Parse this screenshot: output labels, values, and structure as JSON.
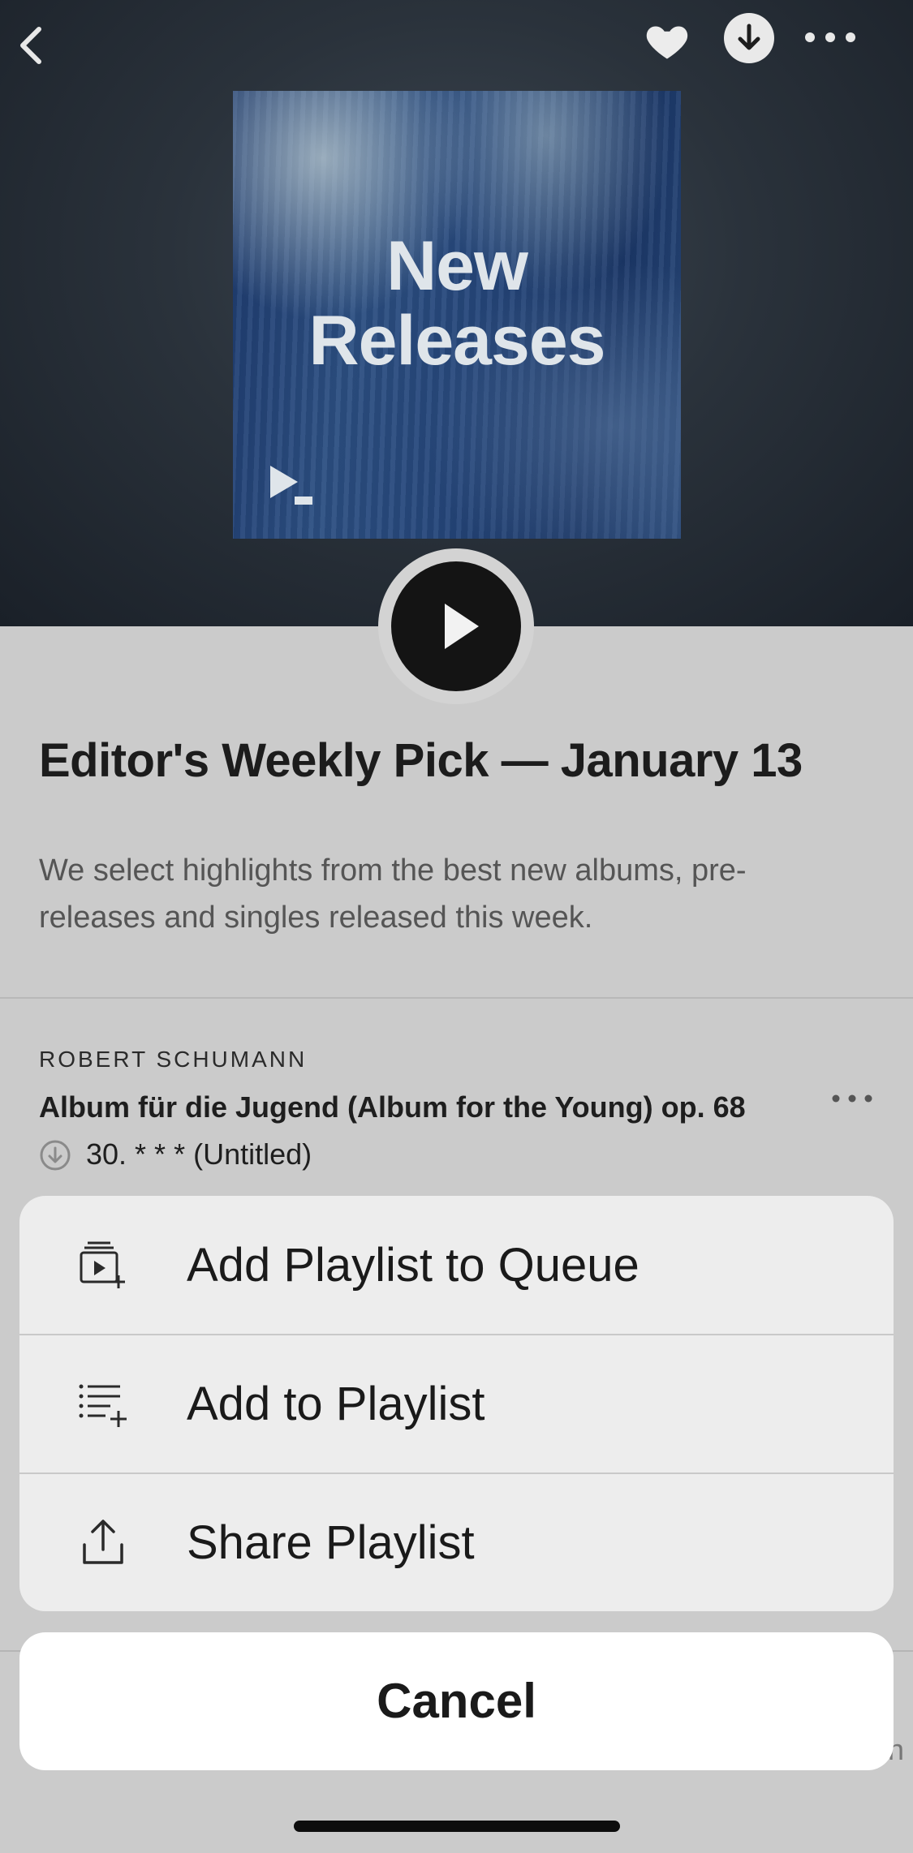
{
  "cover": {
    "title": "New\nReleases"
  },
  "playlist": {
    "title": "Editor's Weekly Pick — January 13",
    "description": "We select highlights from the best new albums, pre-releases and singles released this week."
  },
  "track": {
    "composer": "ROBERT SCHUMANN",
    "work": "Album für die Jugend (Album for the Young) op. 68",
    "title": "30. * * * (Untitled)"
  },
  "action_sheet": {
    "items": [
      {
        "label": "Add Playlist to Queue",
        "icon": "add-to-queue-icon"
      },
      {
        "label": "Add to Playlist",
        "icon": "add-to-playlist-icon"
      },
      {
        "label": "Share Playlist",
        "icon": "share-icon"
      }
    ],
    "cancel_label": "Cancel"
  },
  "partial_text": "n",
  "colors": {
    "hero_bg": "#2a323b",
    "page_bg": "#cbcbcb",
    "sheet_bg": "#eeeeee",
    "play_button": "#141414"
  }
}
